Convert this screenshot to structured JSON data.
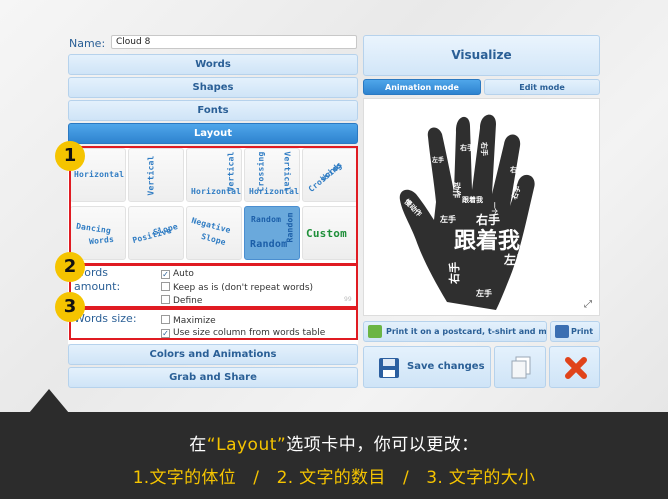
{
  "form": {
    "name_label": "Name:",
    "name_value": "Cloud 8"
  },
  "sections": {
    "words": "Words",
    "shapes": "Shapes",
    "fonts": "Fonts",
    "layout": "Layout",
    "colors": "Colors and Animations",
    "grab": "Grab and Share"
  },
  "layout_styles": {
    "horizontal": "Horizontal",
    "vertical": "Vertical",
    "vh_a": "Vertical",
    "vh_b": "Horizontal",
    "cv_a": "Crossing",
    "cv_b": "Vertical",
    "cv_c": "Horizontal",
    "cw_a": "Crossing",
    "cw_b": "Words",
    "dw_a": "Dancing",
    "dw_b": "Words",
    "ps_a": "Positive",
    "ps_b": "Slope",
    "ns_a": "Negative",
    "ns_b": "Slope",
    "r_a": "Random",
    "r_b": "Random",
    "r_c": "Random",
    "custom": "Custom"
  },
  "words_amount": {
    "label_1": "Words",
    "label_2": "amount:",
    "opt_auto": "Auto",
    "opt_keep": "Keep as is (don't repeat words)",
    "opt_define": "Define",
    "faint_value": "99"
  },
  "words_size": {
    "label": "Words size:",
    "opt_max": "Maximize",
    "opt_use": "Use size column from words table"
  },
  "badges": {
    "b1": "1",
    "b2": "2",
    "b3": "3"
  },
  "right": {
    "visualize": "Visualize",
    "animation_mode": "Animation mode",
    "edit_mode": "Edit mode",
    "print_postcard": "Print it on a postcard, t-shirt and more",
    "print": "Print",
    "save": "Save changes"
  },
  "cloud_words": {
    "big": "跟着我",
    "w1": "右手",
    "w2": "左手",
    "w3": "右手",
    "w4": "左手",
    "w5": "右手",
    "w6": "右手",
    "w7": "左手",
    "w8": "跟着我",
    "w9": "一个",
    "w10": "动作",
    "w11": "右手",
    "w12": "左手",
    "w13": "慢动作",
    "w14": "右手"
  },
  "caption": {
    "line1_pre": "在",
    "line1_quote": "“Layout”",
    "line1_post": "选项卡中，你可以更改：",
    "line2": "1.文字的体位　/　2. 文字的数目　/　3. 文字的大小"
  },
  "colors": {
    "accent": "#2e83cf",
    "highlight": "#f5c400",
    "annotation": "#e01b22"
  }
}
